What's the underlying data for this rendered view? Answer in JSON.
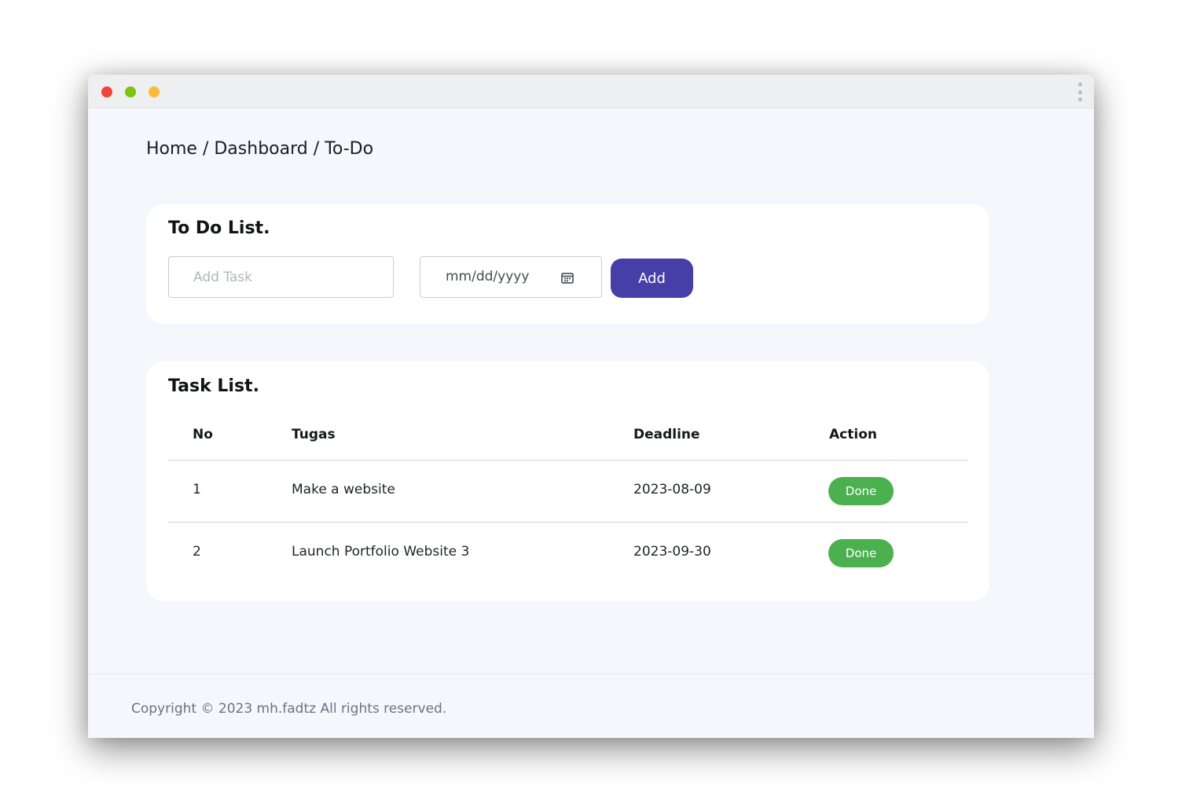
{
  "window": {
    "controls": [
      "close-icon",
      "minimize-icon",
      "maximize-icon"
    ],
    "menu_icon": "kebab-menu-icon"
  },
  "breadcrumb": "Home / Dashboard / To-Do",
  "todo": {
    "title": "To Do List.",
    "task_placeholder": "Add Task",
    "task_value": "",
    "date_placeholder": "mm/dd/yyyy",
    "date_icon": "calendar-icon",
    "add_label": "Add"
  },
  "tasks": {
    "title": "Task List.",
    "columns": [
      "No",
      "Tugas",
      "Deadline",
      "Action"
    ],
    "rows": [
      {
        "no": "1",
        "task": "Make a website",
        "deadline": "2023-08-09",
        "action": "Done"
      },
      {
        "no": "2",
        "task": "Launch Portfolio Website 3",
        "deadline": "2023-09-30",
        "action": "Done"
      }
    ]
  },
  "footer": {
    "copyright": "Copyright © 2023 mh.fadtz All rights reserved."
  },
  "colors": {
    "primary": "#473fa8",
    "success": "#4bb14f",
    "background": "#f5f7fd",
    "close": "#f44336",
    "minimize": "#7cc410",
    "maximize": "#fbbc34"
  }
}
